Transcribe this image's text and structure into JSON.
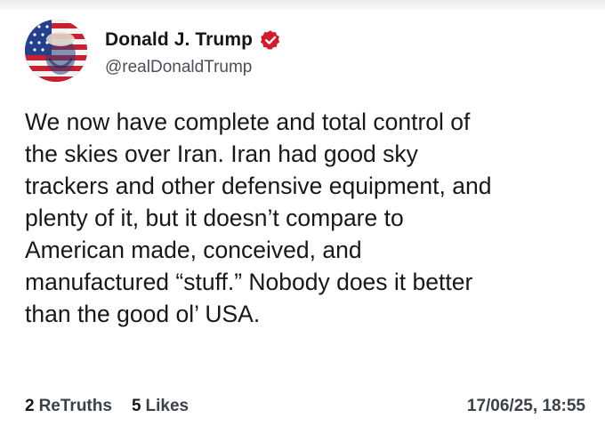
{
  "author": {
    "display_name": "Donald J. Trump",
    "handle": "@realDonaldTrump",
    "verified_icon": "verified-badge-icon",
    "badge_color": "#d7192d"
  },
  "post": {
    "text": "We now have complete and total control of\nthe skies over Iran. Iran had good sky\ntrackers and other defensive equipment, and\nplenty of it, but it doesn’t compare to\nAmerican made, conceived, and\nmanufactured “stuff.” Nobody does it better\nthan the good ol’ USA."
  },
  "stats": {
    "retruths_count": "2",
    "retruths_label": "ReTruths",
    "likes_count": "5",
    "likes_label": "Likes"
  },
  "timestamp": "17/06/25, 18:55"
}
